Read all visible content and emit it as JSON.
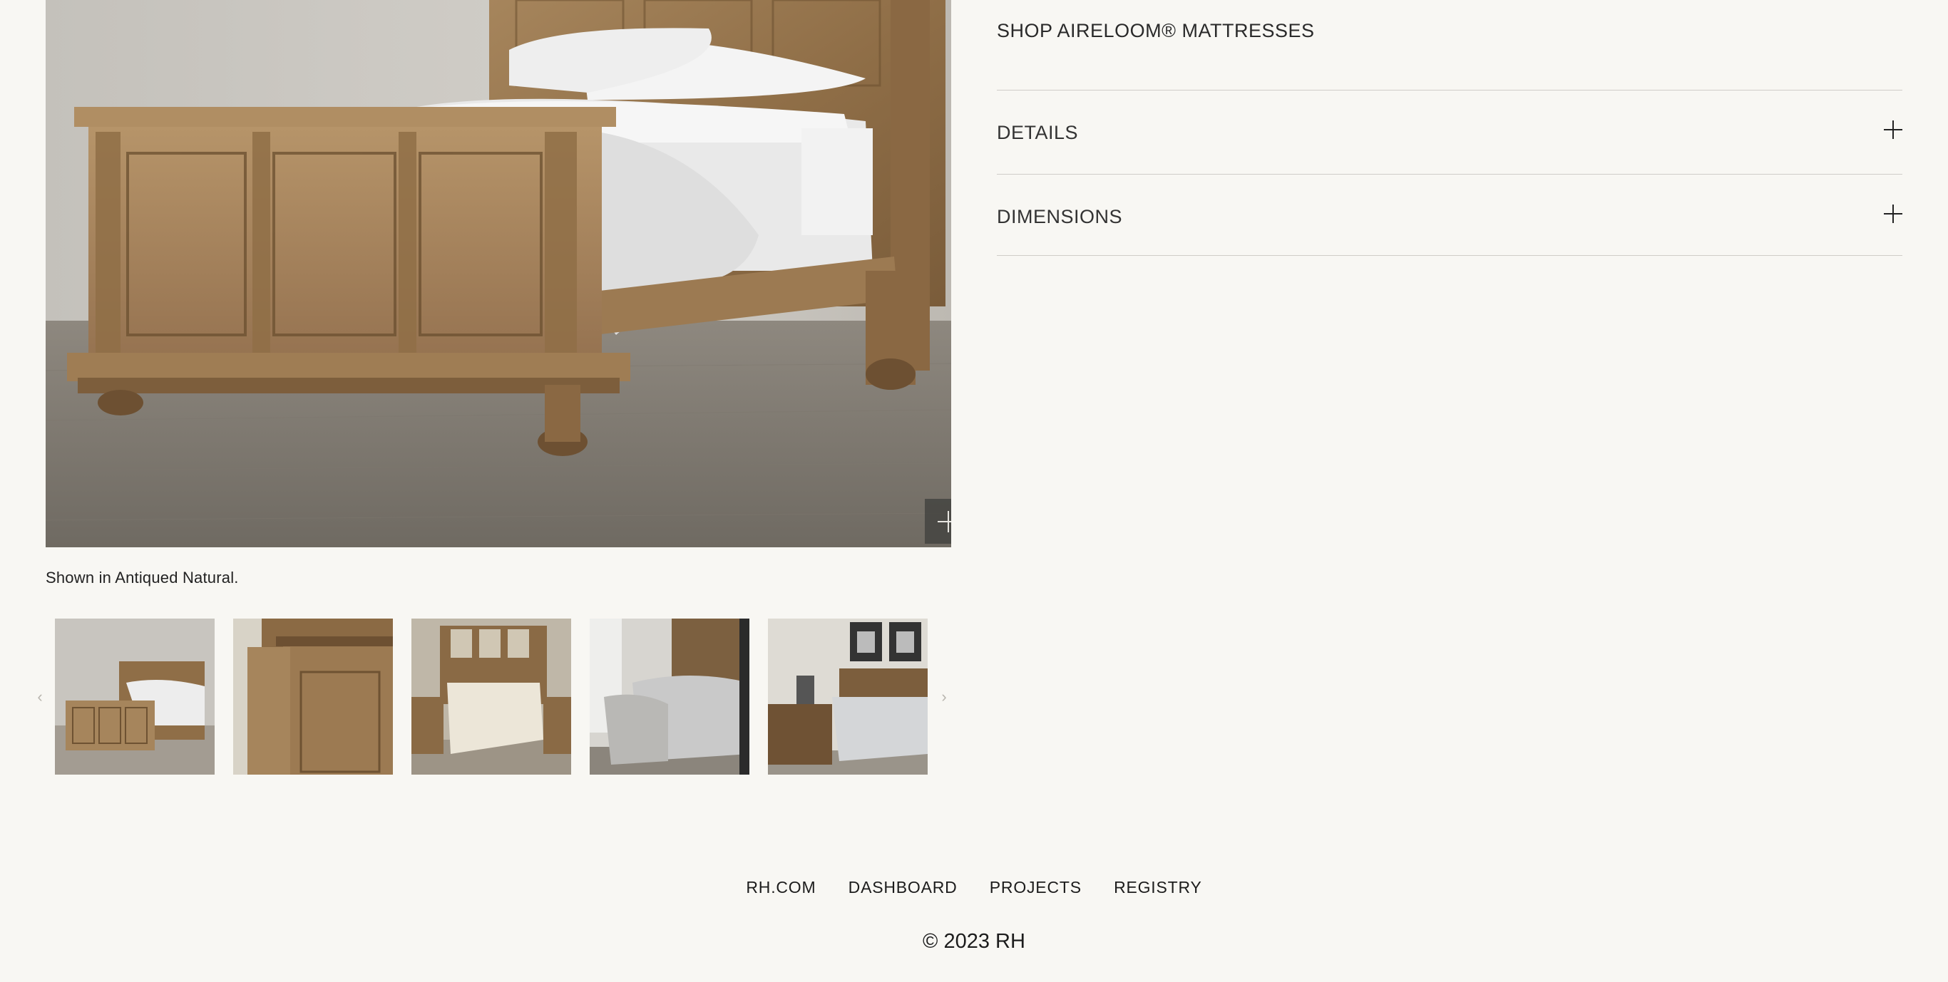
{
  "product": {
    "caption": "Shown in Antiqued Natural.",
    "zoom_icon": "plus-icon",
    "thumbnails": [
      {
        "name": "thumbnail-bed-angled"
      },
      {
        "name": "thumbnail-bed-detail"
      },
      {
        "name": "thumbnail-bed-room-cream"
      },
      {
        "name": "thumbnail-bed-room-grey"
      },
      {
        "name": "thumbnail-bed-room-art"
      }
    ]
  },
  "sidebar": {
    "shop_link": "SHOP AIRELOOM® MATTRESSES",
    "accordions": [
      {
        "label": "DETAILS"
      },
      {
        "label": "DIMENSIONS"
      }
    ]
  },
  "footer": {
    "links": [
      "RH.COM",
      "DASHBOARD",
      "PROJECTS",
      "REGISTRY"
    ],
    "copyright": "© 2023 RH"
  },
  "colors": {
    "background": "#f8f7f3",
    "wood": "#9c7a52",
    "divider": "#cfcdc8"
  }
}
